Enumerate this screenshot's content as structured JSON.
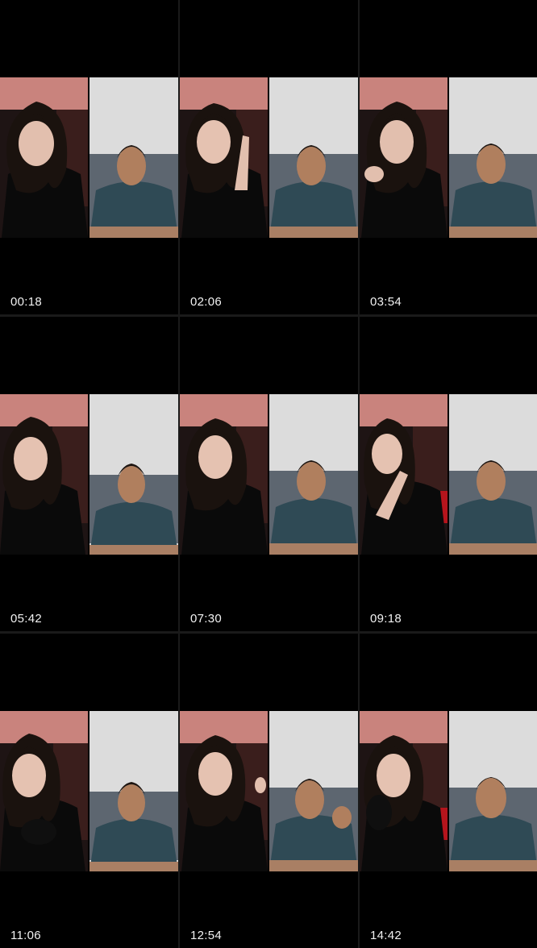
{
  "app": {
    "layout": "3x3 thumbnail grid of a split-screen video call"
  },
  "thumbnails": [
    {
      "timestamp": "00:18"
    },
    {
      "timestamp": "02:06"
    },
    {
      "timestamp": "03:54"
    },
    {
      "timestamp": "05:42"
    },
    {
      "timestamp": "07:30"
    },
    {
      "timestamp": "09:18"
    },
    {
      "timestamp": "11:06"
    },
    {
      "timestamp": "12:54"
    },
    {
      "timestamp": "14:42"
    }
  ],
  "colors": {
    "background": "#000000",
    "divider": "#1a1a1a",
    "timestamp_text": "#f2f2f2",
    "left_wall": "#c9837d",
    "right_wall": "#dcdcdc",
    "shirt": "#2f4a55"
  }
}
